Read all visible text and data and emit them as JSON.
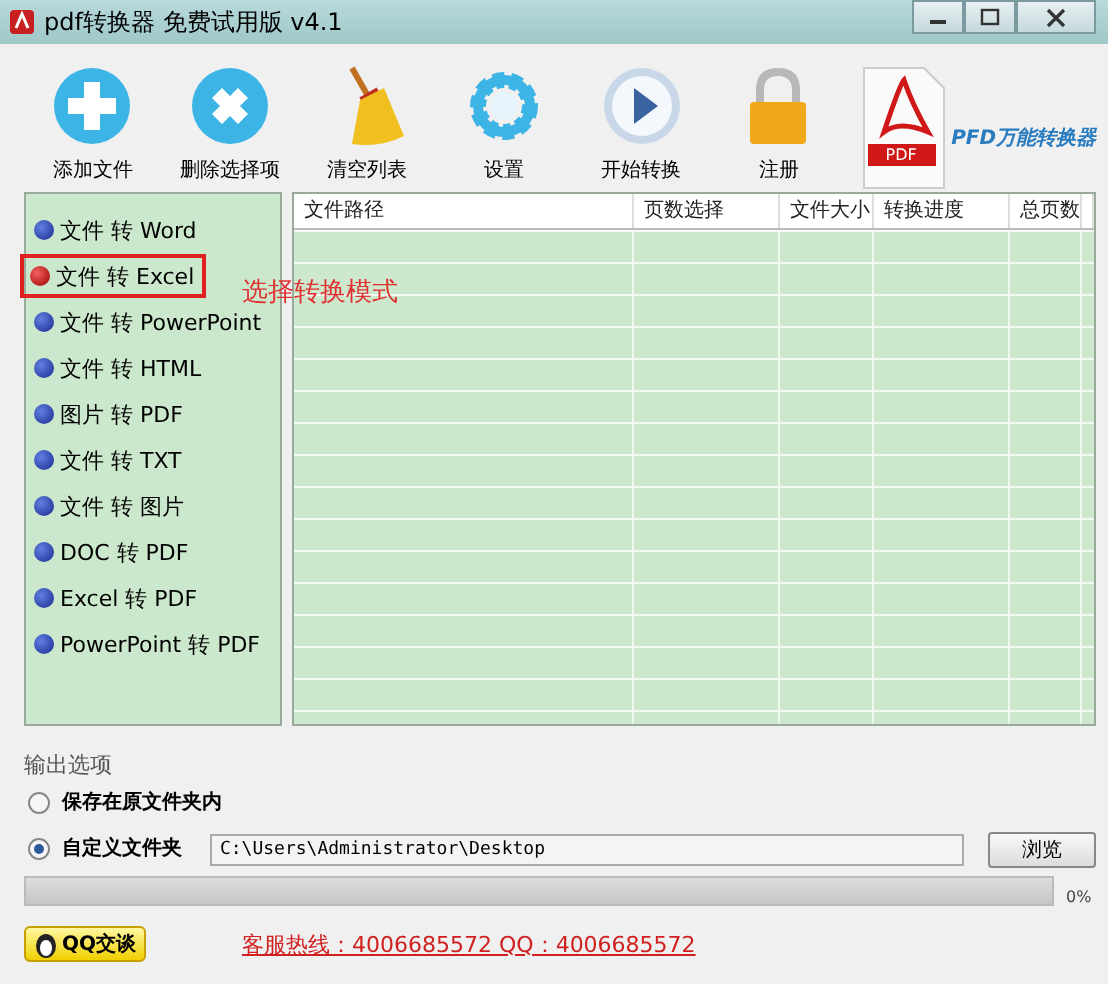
{
  "window": {
    "title": "pdf转换器 免费试用版 v4.1"
  },
  "toolbar": [
    {
      "kind": "add",
      "label": "添加文件"
    },
    {
      "kind": "delete",
      "label": "删除选择项"
    },
    {
      "kind": "clear",
      "label": "清空列表"
    },
    {
      "kind": "settings",
      "label": "设置"
    },
    {
      "kind": "start",
      "label": "开始转换"
    },
    {
      "kind": "register",
      "label": "注册"
    }
  ],
  "brand": {
    "icon_label": "PDF",
    "text": "PFD万能转换器"
  },
  "modes": [
    {
      "label": "文件 转 Word",
      "selected": false
    },
    {
      "label": "文件 转 Excel",
      "selected": true
    },
    {
      "label": "文件 转 PowerPoint",
      "selected": false
    },
    {
      "label": "文件 转 HTML",
      "selected": false
    },
    {
      "label": "图片 转 PDF",
      "selected": false
    },
    {
      "label": "文件 转 TXT",
      "selected": false
    },
    {
      "label": "文件 转 图片",
      "selected": false
    },
    {
      "label": "DOC 转 PDF",
      "selected": false
    },
    {
      "label": "Excel 转 PDF",
      "selected": false
    },
    {
      "label": "PowerPoint 转 PDF",
      "selected": false
    }
  ],
  "annotation": {
    "text": "选择转换模式"
  },
  "table": {
    "columns": [
      "文件路径",
      "页数选择",
      "文件大小",
      "转换进度",
      "总页数"
    ]
  },
  "output": {
    "title": "输出选项",
    "options": [
      {
        "label": "保存在原文件夹内",
        "selected": false
      },
      {
        "label": "自定义文件夹",
        "selected": true
      }
    ],
    "path": "C:\\Users\\Administrator\\Desktop",
    "browse": "浏览"
  },
  "progress": {
    "level": 0,
    "reading": "0%"
  },
  "footer": {
    "qq_button": "QQ交谈",
    "hotline": "客服热线：4006685572 QQ：4006685572"
  }
}
